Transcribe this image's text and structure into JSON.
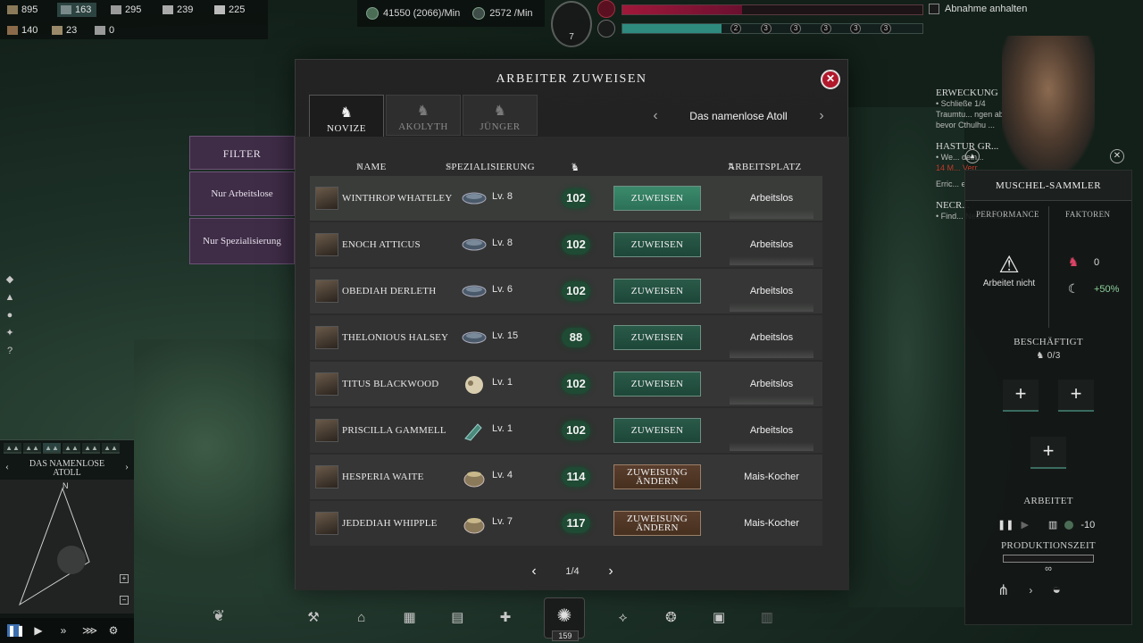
{
  "resources": {
    "row1": [
      {
        "icon": "wood-icon",
        "value": "895"
      },
      {
        "icon": "stone-icon",
        "value": "163",
        "highlight": true
      },
      {
        "icon": "crates-icon",
        "value": "295"
      },
      {
        "icon": "buildings-icon",
        "value": "239"
      },
      {
        "icon": "cogs-icon",
        "value": "225"
      }
    ],
    "row2": [
      {
        "icon": "planks-icon",
        "value": "140"
      },
      {
        "icon": "food-icon",
        "value": "23"
      },
      {
        "icon": "gear-icon",
        "value": "0"
      }
    ]
  },
  "top_center": {
    "income1": "41550 (2066)/Min",
    "income2": "2572 /Min"
  },
  "medallion_number": "7",
  "threat_fill_fraction": 0.4,
  "progress_fill_fraction": 0.33,
  "progress_markers": [
    "2",
    "3",
    "3",
    "3",
    "3",
    "3"
  ],
  "pause_label": "Abnahme anhalten",
  "filter": {
    "heading": "FILTER",
    "options": [
      "Nur Arbeitslose",
      "Nur Spezialisierung"
    ]
  },
  "dialog": {
    "title": "ARBEITER ZUWEISEN",
    "close": "✕",
    "tabs": [
      "NOVIZE",
      "AKOLYTH",
      "JÜNGER"
    ],
    "location": "Das namenlose Atoll",
    "columns": {
      "name": "NAME",
      "spec": "SPEZIALISIERUNG",
      "workplace": "ARBEITSPLATZ"
    },
    "workers": [
      {
        "name": "WINTHROP WHATELEY",
        "spec_icon": "shell-bowl-icon",
        "level": "Lv. 8",
        "score": "102",
        "action": "ZUWEISEN",
        "workplace": "Arbeitslos"
      },
      {
        "name": "ENOCH ATTICUS",
        "spec_icon": "shell-bowl-icon",
        "level": "Lv. 8",
        "score": "102",
        "action": "ZUWEISEN",
        "workplace": "Arbeitslos"
      },
      {
        "name": "OBEDIAH DERLETH",
        "spec_icon": "shell-bowl-icon",
        "level": "Lv. 6",
        "score": "102",
        "action": "ZUWEISEN",
        "workplace": "Arbeitslos"
      },
      {
        "name": "THELONIOUS HALSEY",
        "spec_icon": "shell-bowl-icon",
        "level": "Lv. 15",
        "score": "88",
        "action": "ZUWEISEN",
        "workplace": "Arbeitslos"
      },
      {
        "name": "TITUS BLACKWOOD",
        "spec_icon": "sheep-icon",
        "level": "Lv. 1",
        "score": "102",
        "action": "ZUWEISEN",
        "workplace": "Arbeitslos"
      },
      {
        "name": "PRISCILLA GAMMELL",
        "spec_icon": "sickle-icon",
        "level": "Lv. 1",
        "score": "102",
        "action": "ZUWEISEN",
        "workplace": "Arbeitslos"
      },
      {
        "name": "HESPERIA WAITE",
        "spec_icon": "cauldron-icon",
        "level": "Lv. 4",
        "score": "114",
        "action": "ZUWEISUNG ÄNDERN",
        "workplace": "Mais-Kocher"
      },
      {
        "name": "JEDEDIAH WHIPPLE",
        "spec_icon": "cauldron-icon",
        "level": "Lv. 7",
        "score": "117",
        "action": "ZUWEISUNG ÄNDERN",
        "workplace": "Mais-Kocher"
      }
    ],
    "page": "1/4"
  },
  "minimap": {
    "title": "DAS NAMENLOSE ATOLL",
    "compass": "N"
  },
  "quests": {
    "q1_title": "ERWECKUNG",
    "q1_text": "• Schließe 1/4 Traumtu... ngen ab, bevor Cthulhu ...",
    "q2_title": "HASTUR GR...",
    "q2_text": "• We... dein...",
    "q2_extra": "14 M... Verr...",
    "q3_text": "Erric... emp...",
    "q4_title": "NECR...",
    "q4_text": "• Find... Necr... Mutt..."
  },
  "worker_panel": {
    "title": "MUSCHEL-SAMMLER",
    "performance_label": "PERFORMANCE",
    "factors_label": "FAKTOREN",
    "warning": "Arbeitet nicht",
    "factor1": "0",
    "factor2": "+50%",
    "employed_label": "BESCHÄFTIGT",
    "employed_count": "0/3",
    "working_label": "ARBEITET",
    "working_value": "-10",
    "production_label": "PRODUKTIONSZEIT",
    "infinity": "∞"
  },
  "bottom_bar": {
    "population": "159"
  }
}
